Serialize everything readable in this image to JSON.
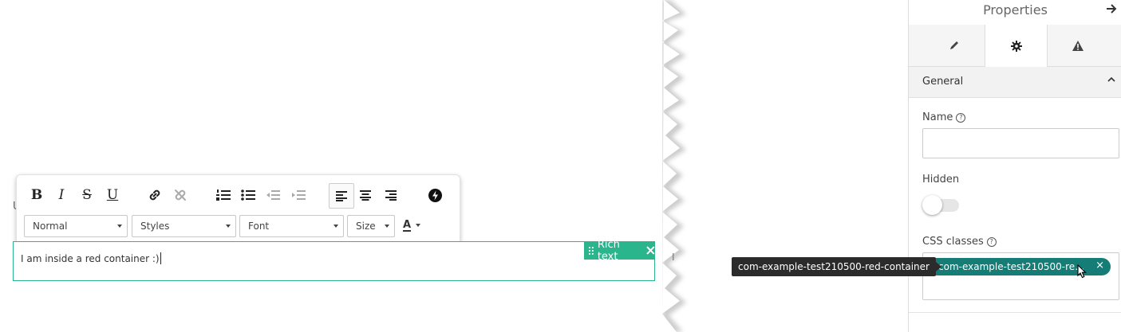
{
  "toolbar": {
    "bold": "B",
    "italic": "I",
    "strike": "S",
    "underline": "U",
    "format": "Normal",
    "styles": "Styles",
    "font": "Font",
    "size": "Size",
    "text_color_glyph": "A"
  },
  "canvas": {
    "partial_label": "U",
    "editor_text": "I am inside a red container :)",
    "rich_text_tag": "Rich text",
    "stray_glyph": "I",
    "accent_color": "#2bb58c"
  },
  "panel": {
    "title": "Properties",
    "section": "General",
    "name_label": "Name",
    "name_value": "",
    "hidden_label": "Hidden",
    "css_label": "CSS classes",
    "css_chip": "com-example-test210500-red-container",
    "chip_color": "#157d76"
  },
  "tooltip": {
    "text": "com-example-test210500-red-container"
  }
}
